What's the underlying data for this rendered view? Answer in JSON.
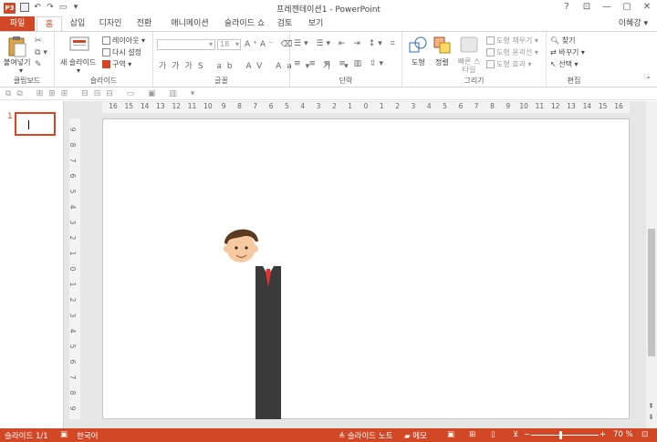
{
  "window": {
    "title": "프레젠테이션1 - PowerPoint",
    "app_icon": "P3",
    "user": "이혜강 ▾",
    "controls": [
      "?",
      "⊡",
      "—",
      "▢",
      "✕"
    ]
  },
  "tabs": [
    "파일",
    "홈",
    "삽입",
    "디자인",
    "전환",
    "애니메이션",
    "슬라이드 쇼",
    "검토",
    "보기"
  ],
  "active_tab": "홈",
  "ribbon": {
    "clipboard": {
      "paste_label": "붙여넣기",
      "group_label": "클립보드"
    },
    "slides": {
      "new_slide_label": "새 슬라이드",
      "layout_label": "레이아웃",
      "reset_label": "다시 설정",
      "section_label": "구역",
      "group_label": "슬라이드"
    },
    "font": {
      "font_name_placeholder": "",
      "font_size": "18",
      "group_label": "글꼴"
    },
    "paragraph": {
      "group_label": "단락"
    },
    "drawing": {
      "shapes_label": "도형",
      "arrange_label": "정렬",
      "quick_styles_label": "빠른 스타일",
      "fill_label": "도형 채우기",
      "outline_label": "도형 윤곽선",
      "effects_label": "도형 효과",
      "group_label": "그리기"
    },
    "editing": {
      "find_label": "찾기",
      "replace_label": "바꾸기",
      "select_label": "선택",
      "group_label": "편집"
    }
  },
  "ruler": {
    "h_labels": [
      "16",
      "15",
      "14",
      "13",
      "12",
      "11",
      "10",
      "9",
      "8",
      "7",
      "6",
      "5",
      "4",
      "3",
      "2",
      "1",
      "0",
      "1",
      "2",
      "3",
      "4",
      "5",
      "6",
      "7",
      "8",
      "9",
      "10",
      "11",
      "12",
      "13",
      "14",
      "15",
      "16"
    ],
    "v_labels": [
      "9",
      "8",
      "7",
      "6",
      "5",
      "4",
      "3",
      "2",
      "1",
      "0",
      "1",
      "2",
      "3",
      "4",
      "5",
      "6",
      "7",
      "8",
      "9"
    ]
  },
  "slides_panel": {
    "slide_number": "1"
  },
  "status": {
    "slide_info": "슬라이드 1/1",
    "language": "한국어",
    "notes_label": "슬라이드 노트",
    "comments_label": "메모",
    "zoom": "70 %"
  },
  "colors": {
    "accent": "#d24726",
    "suit": "#3a3a3a",
    "tie": "#e8312f",
    "hair": "#5a3b22",
    "skin": "#f6c9a0"
  }
}
